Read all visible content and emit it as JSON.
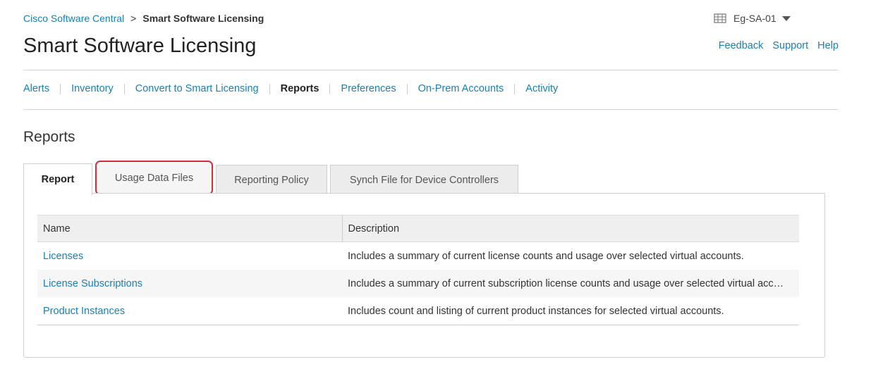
{
  "breadcrumb": {
    "parent": "Cisco Software Central",
    "separator": ">",
    "current": "Smart Software Licensing"
  },
  "account": {
    "name": "Eg-SA-01",
    "icon": "building-icon"
  },
  "page_title": "Smart Software Licensing",
  "top_links": {
    "feedback": "Feedback",
    "support": "Support",
    "help": "Help"
  },
  "nav": {
    "items": [
      {
        "label": "Alerts"
      },
      {
        "label": "Inventory"
      },
      {
        "label": "Convert to Smart Licensing"
      },
      {
        "label": "Reports"
      },
      {
        "label": "Preferences"
      },
      {
        "label": "On-Prem Accounts"
      },
      {
        "label": "Activity"
      }
    ],
    "active": "Reports"
  },
  "section_title": "Reports",
  "tabs": [
    {
      "label": "Report"
    },
    {
      "label": "Usage Data Files"
    },
    {
      "label": "Reporting Policy"
    },
    {
      "label": "Synch File for Device Controllers"
    }
  ],
  "table": {
    "headers": {
      "name": "Name",
      "description": "Description"
    },
    "rows": [
      {
        "name": "Licenses",
        "description": "Includes a summary of current license counts and usage over selected virtual accounts."
      },
      {
        "name": "License Subscriptions",
        "description": "Includes a summary of current subscription license counts and usage over selected virtual acc…"
      },
      {
        "name": "Product Instances",
        "description": "Includes count and listing of current product instances for selected virtual accounts."
      }
    ]
  },
  "colors": {
    "link": "#1a7fb5",
    "highlight_border": "#d0303a",
    "tab_inactive_bg": "#ececec",
    "table_header_bg": "#efefef"
  }
}
